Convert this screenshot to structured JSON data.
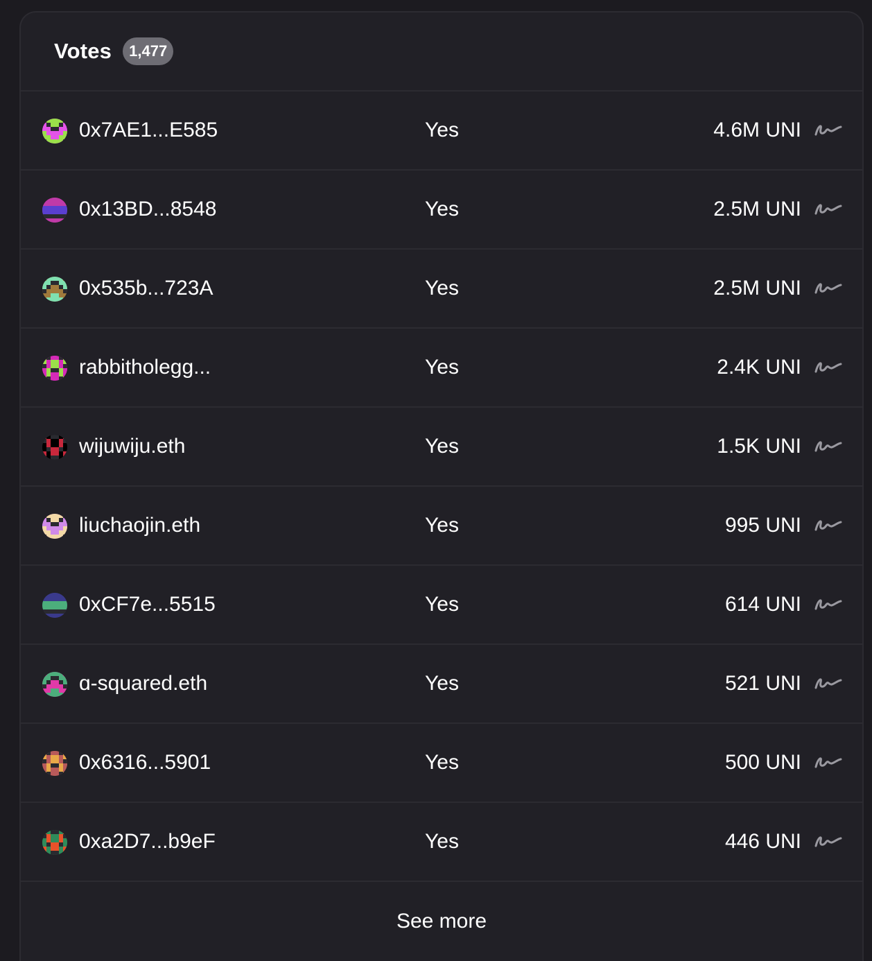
{
  "votes": {
    "title": "Votes",
    "count": "1,477",
    "see_more_label": "See more",
    "rows": [
      {
        "voter": "0x7AE1...E585",
        "choice": "Yes",
        "amount": "4.6M UNI",
        "avatar_icon": "pixel-avatar-icon",
        "colors": [
          "#e454e8",
          "#9be04a"
        ]
      },
      {
        "voter": "0x13BD...8548",
        "choice": "Yes",
        "amount": "2.5M UNI",
        "avatar_icon": "pixel-avatar-icon",
        "colors": [
          "#c03aa8",
          "#5a3fd0"
        ]
      },
      {
        "voter": "0x535b...723A",
        "choice": "Yes",
        "amount": "2.5M UNI",
        "avatar_icon": "pixel-avatar-icon",
        "colors": [
          "#a07a3c",
          "#7fe0b0"
        ]
      },
      {
        "voter": "rabbitholegg...",
        "choice": "Yes",
        "amount": "2.4K UNI",
        "avatar_icon": "pixel-avatar-icon",
        "colors": [
          "#d62ab8",
          "#9be04a"
        ]
      },
      {
        "voter": "wijuwiju.eth",
        "choice": "Yes",
        "amount": "1.5K UNI",
        "avatar_icon": "nft-avatar-icon",
        "colors": [
          "#000000",
          "#c8283c"
        ]
      },
      {
        "voter": "liuchaojin.eth",
        "choice": "Yes",
        "amount": "995 UNI",
        "avatar_icon": "nft-avatar-icon",
        "colors": [
          "#d08ae8",
          "#f3d9a6"
        ]
      },
      {
        "voter": "0xCF7e...5515",
        "choice": "Yes",
        "amount": "614 UNI",
        "avatar_icon": "pixel-avatar-icon",
        "colors": [
          "#3a3a8c",
          "#4cae7c"
        ]
      },
      {
        "voter": "ɑ-squared.eth",
        "choice": "Yes",
        "amount": "521 UNI",
        "avatar_icon": "pixel-avatar-icon",
        "colors": [
          "#e03aa8",
          "#4cae7c"
        ]
      },
      {
        "voter": "0x6316...5901",
        "choice": "Yes",
        "amount": "500 UNI",
        "avatar_icon": "pixel-avatar-icon",
        "colors": [
          "#b85a5a",
          "#e8a848"
        ]
      },
      {
        "voter": "0xa2D7...b9eF",
        "choice": "Yes",
        "amount": "446 UNI",
        "avatar_icon": "pixel-avatar-icon",
        "colors": [
          "#2f8c5a",
          "#e8522a"
        ]
      }
    ]
  },
  "theme": {
    "page_bg": "#1c1b20",
    "card_bg": "#212026",
    "divider": "#2c2b31",
    "badge_bg": "#6e6d74",
    "signature_color": "#9a99a0"
  }
}
